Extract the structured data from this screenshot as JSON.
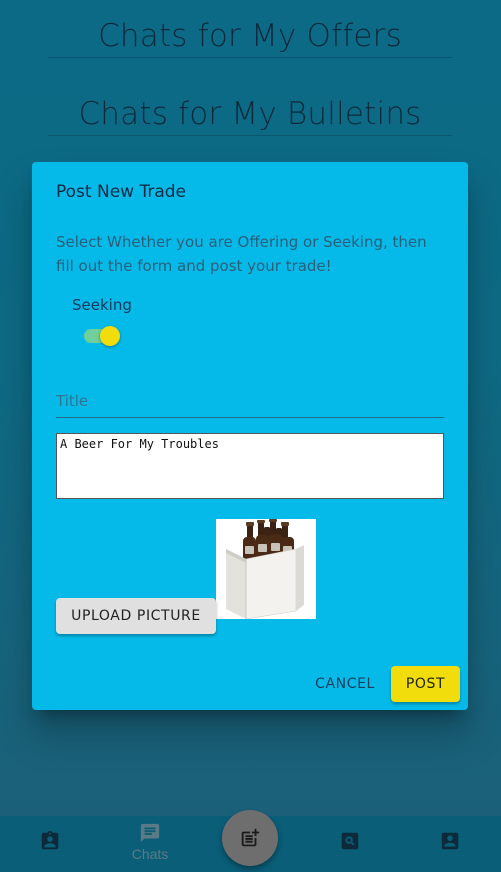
{
  "background": {
    "heading_offers": "Chats for My Offers",
    "heading_bulletins": "Chats for My Bulletins"
  },
  "dialog": {
    "title": "Post New Trade",
    "instructions": "Select Whether you are Offering or Seeking, then fill out the form and post your trade!",
    "switch_label": "Seeking",
    "switch_on": true,
    "title_placeholder": "Title",
    "description_value": "A Beer For My Troubles",
    "upload_label": "UPLOAD PICTURE",
    "cancel_label": "CANCEL",
    "post_label": "POST",
    "image_subject": "six-pack of beer bottles"
  },
  "bottom_nav": {
    "items": [
      {
        "icon": "contacts-badge-icon",
        "label": ""
      },
      {
        "icon": "chat-icon",
        "label": "Chats"
      },
      {
        "icon": "post-add-icon",
        "label": ""
      },
      {
        "icon": "search-box-icon",
        "label": ""
      },
      {
        "icon": "account-box-icon",
        "label": ""
      }
    ]
  },
  "colors": {
    "dialog_bg": "#05bae9",
    "accent_yellow": "#f2dd0c",
    "switch_track": "#6fd09b",
    "nav_bg": "#0a5e78"
  }
}
